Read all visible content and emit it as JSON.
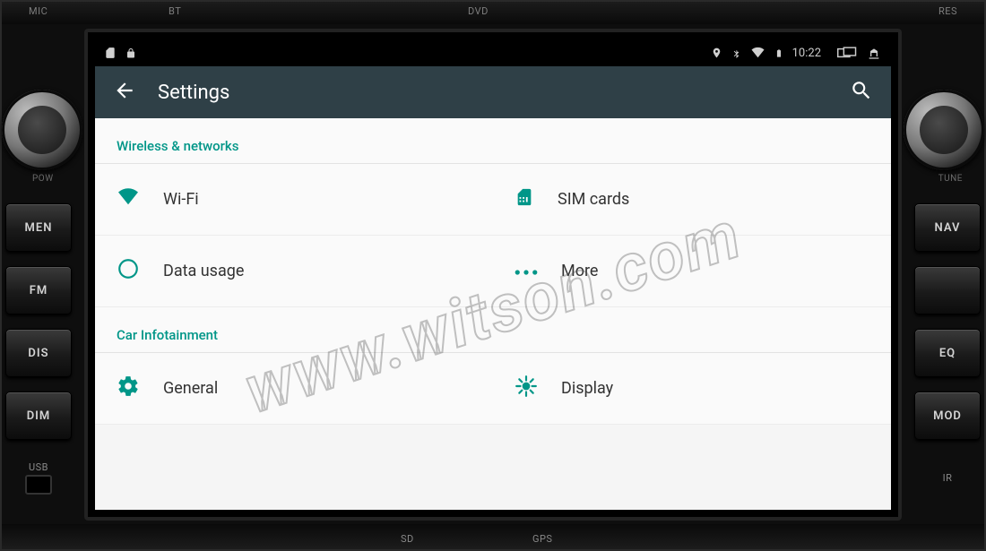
{
  "chassis": {
    "top": {
      "mic": "MIC",
      "bt": "BT",
      "dvd": "DVD",
      "res": "RES"
    },
    "bottom": {
      "sd": "SD",
      "gps": "GPS"
    },
    "knob_left_sub": "POW",
    "knob_right_sub": "TUNE",
    "left_buttons": [
      "MEN",
      "FM",
      "DIS",
      "DIM"
    ],
    "right_buttons": [
      "NAV",
      "",
      "EQ",
      "MOD"
    ],
    "usb_label": "USB",
    "ir_label": "IR"
  },
  "statusbar": {
    "time": "10:22"
  },
  "toolbar": {
    "title": "Settings"
  },
  "sections": [
    {
      "header": "Wireless & networks",
      "rows": [
        {
          "left": {
            "icon": "wifi",
            "label": "Wi-Fi"
          },
          "right": {
            "icon": "sim",
            "label": "SIM cards"
          }
        },
        {
          "left": {
            "icon": "data",
            "label": "Data usage"
          },
          "right": {
            "icon": "more",
            "label": "More"
          }
        }
      ]
    },
    {
      "header": "Car Infotainment",
      "rows": [
        {
          "left": {
            "icon": "gear",
            "label": "General"
          },
          "right": {
            "icon": "display",
            "label": "Display"
          }
        }
      ]
    }
  ],
  "watermark": "www.witson.com"
}
